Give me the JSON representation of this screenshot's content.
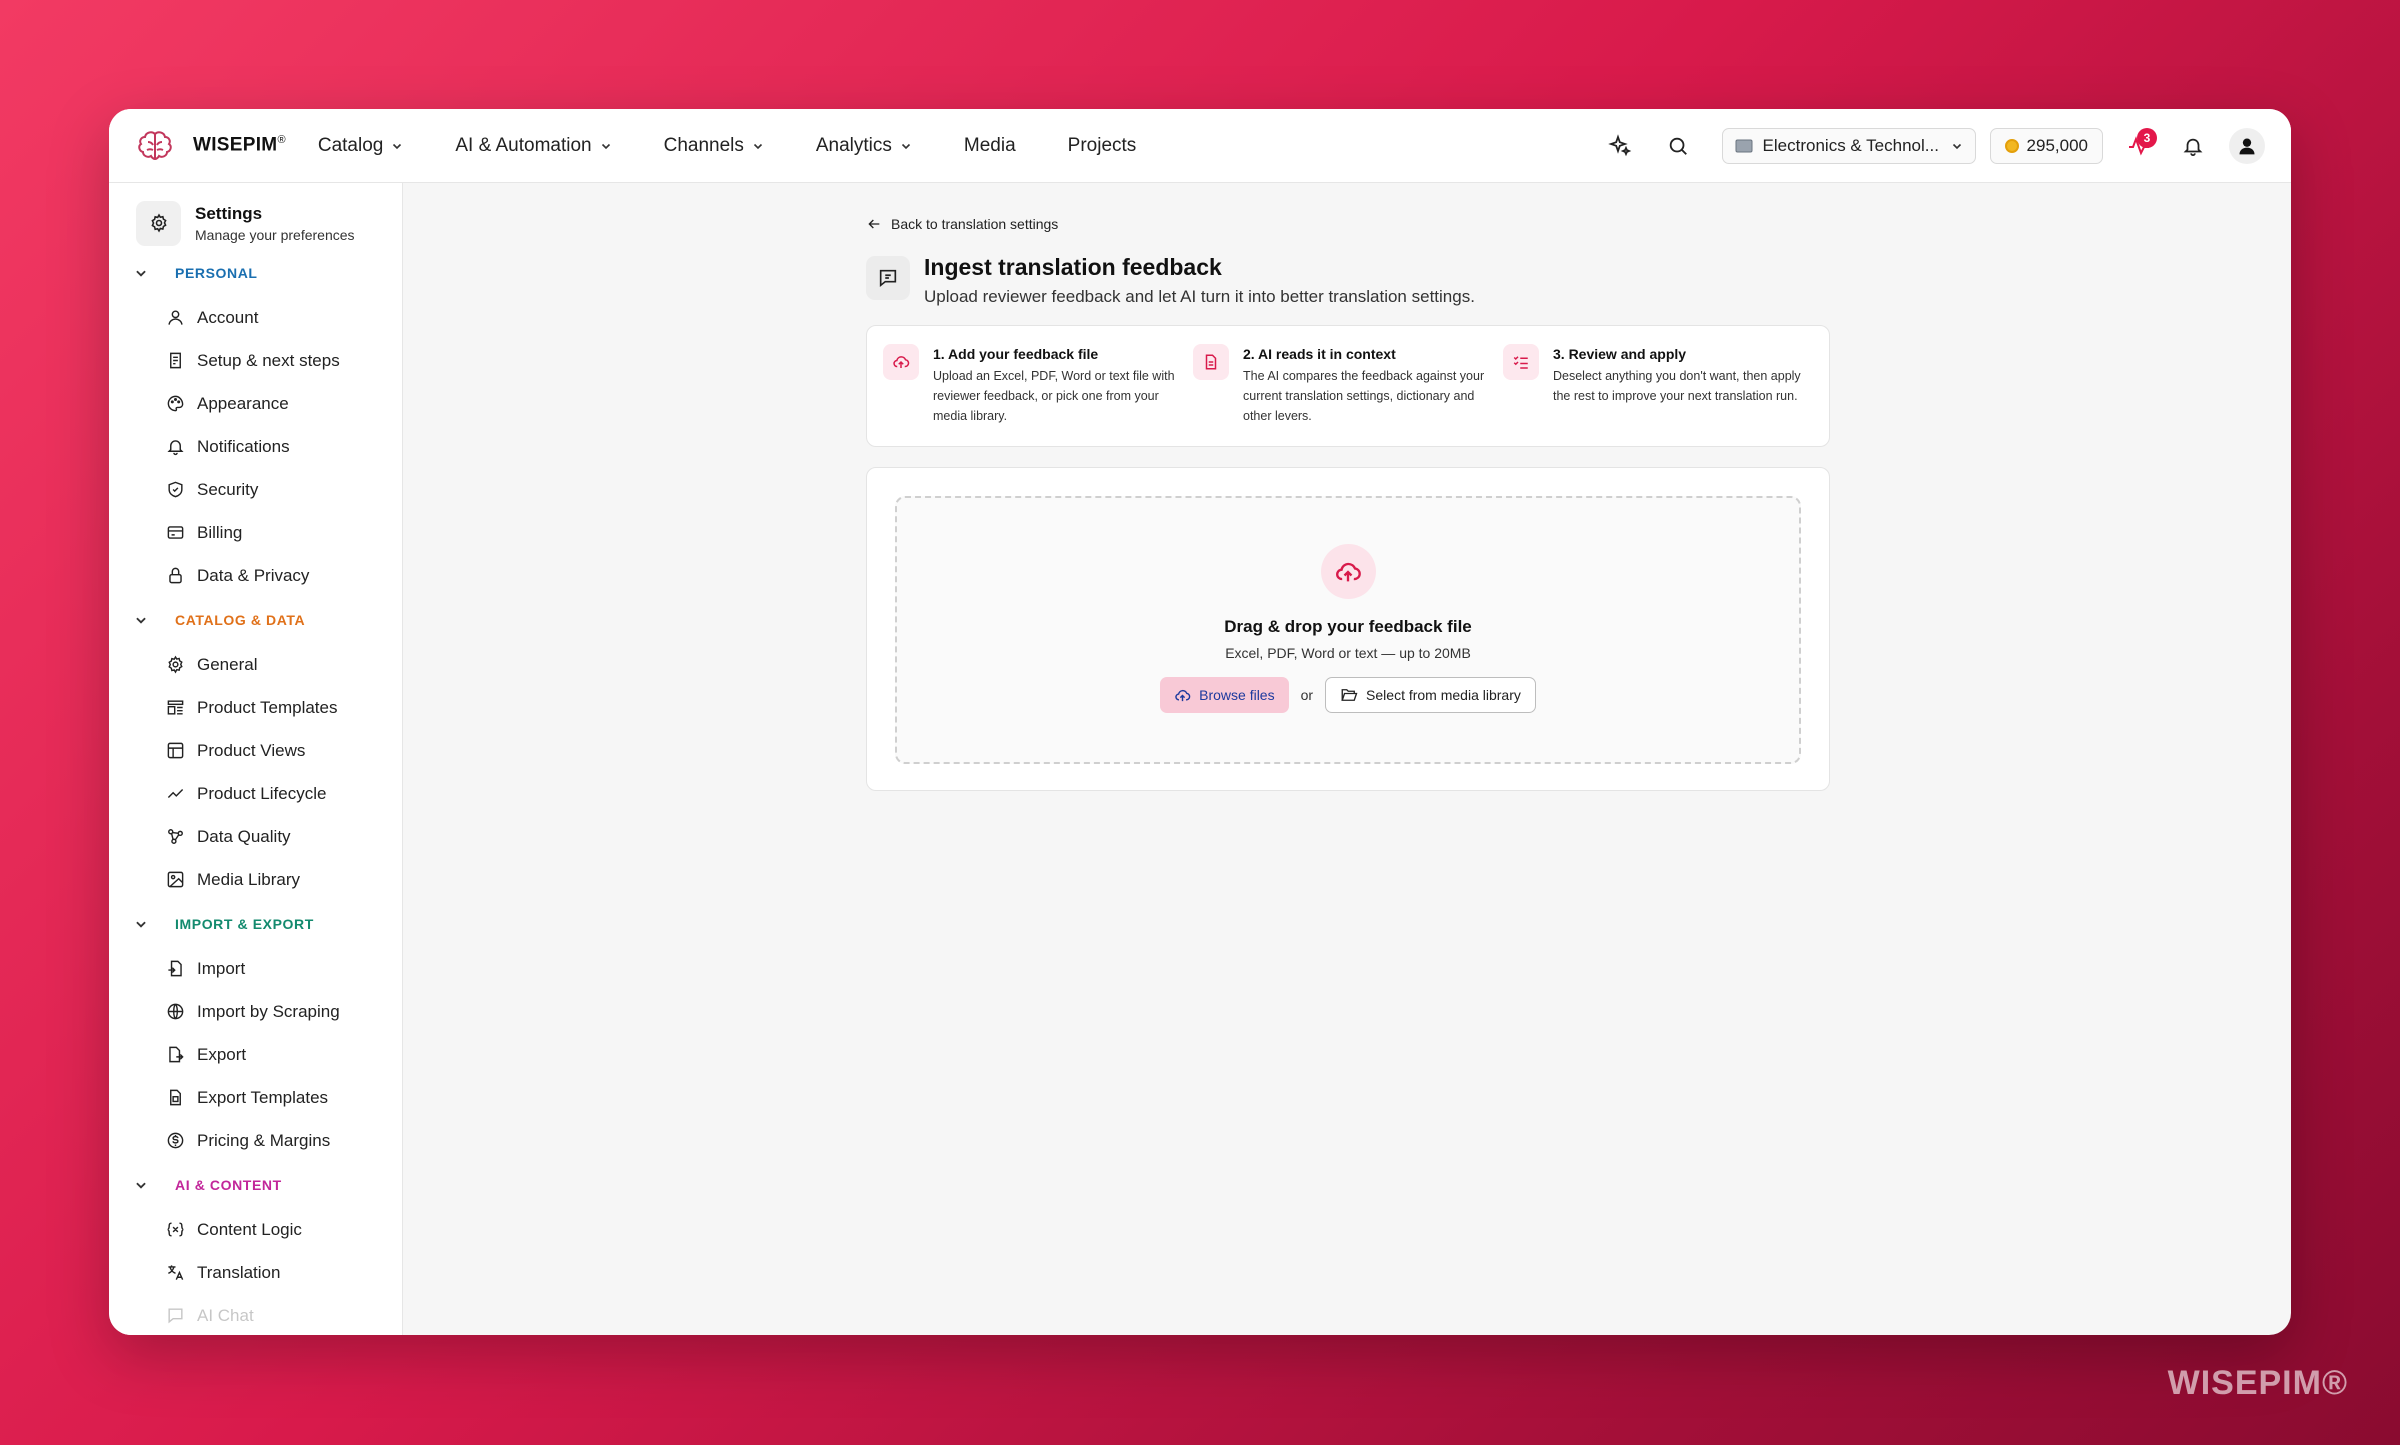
{
  "brand": {
    "name": "WISEPIM",
    "reg": "®",
    "watermark": "WISEPIM®"
  },
  "nav": {
    "items": [
      {
        "label": "Catalog",
        "dropdown": true
      },
      {
        "label": "AI & Automation",
        "dropdown": true
      },
      {
        "label": "Channels",
        "dropdown": true
      },
      {
        "label": "Analytics",
        "dropdown": true
      },
      {
        "label": "Media",
        "dropdown": false
      },
      {
        "label": "Projects",
        "dropdown": false
      }
    ]
  },
  "topbar": {
    "workspace": "Electronics & Technol...",
    "credits": "295,000",
    "activity_badge": "3"
  },
  "sidebar": {
    "title": "Settings",
    "subtitle": "Manage your preferences",
    "sections": [
      {
        "label": "PERSONAL",
        "color": "#1a6fb0",
        "items": [
          "Account",
          "Setup & next steps",
          "Appearance",
          "Notifications",
          "Security",
          "Billing",
          "Data & Privacy"
        ]
      },
      {
        "label": "CATALOG & DATA",
        "color": "#e0711a",
        "items": [
          "General",
          "Product Templates",
          "Product Views",
          "Product Lifecycle",
          "Data Quality",
          "Media Library"
        ]
      },
      {
        "label": "IMPORT & EXPORT",
        "color": "#138a6e",
        "items": [
          "Import",
          "Import by Scraping",
          "Export",
          "Export Templates",
          "Pricing & Margins"
        ]
      },
      {
        "label": "AI & CONTENT",
        "color": "#c2269a",
        "items": [
          "Content Logic",
          "Translation",
          "AI Chat"
        ]
      }
    ]
  },
  "main": {
    "back_label": "Back to translation settings",
    "title": "Ingest translation feedback",
    "subtitle": "Upload reviewer feedback and let AI turn it into better translation settings.",
    "steps": [
      {
        "title": "1. Add your feedback file",
        "desc": "Upload an Excel, PDF, Word or text file with reviewer feedback, or pick one from your media library."
      },
      {
        "title": "2. AI reads it in context",
        "desc": "The AI compares the feedback against your current translation settings, dictionary and other levers."
      },
      {
        "title": "3. Review and apply",
        "desc": "Deselect anything you don't want, then apply the rest to improve your next translation run."
      }
    ],
    "dropzone": {
      "title": "Drag & drop your feedback file",
      "subtitle": "Excel, PDF, Word or text — up to 20MB",
      "browse_label": "Browse files",
      "or_label": "or",
      "media_label": "Select from media library"
    }
  },
  "colors": {
    "accent": "#e3174a",
    "accent_soft": "#fde8ee",
    "background": "#f6f6f6"
  }
}
